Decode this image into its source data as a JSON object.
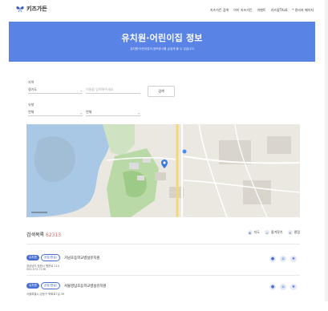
{
  "header": {
    "brand": "키즈가든",
    "nav": [
      "키즈가든 검색",
      "아이 키즈가든",
      "이벤트",
      "키즈맘TALK",
      "* 관리자 페이지"
    ]
  },
  "hero": {
    "title": "유치원·어린이집 정보",
    "subtitle": "유치원·어린이집의 정보공시를 손쉽게 볼 수 있습니다"
  },
  "search": {
    "region_label": "지역",
    "region_value": "경기도",
    "name_placeholder": "이름을 입력해주세요",
    "search_button": "검색",
    "type_label": "유형",
    "type_value": "전체",
    "type2_value": "전체"
  },
  "results": {
    "label": "검색목록",
    "count": "62313",
    "filters": [
      "지도",
      "즐겨찾기",
      "평점"
    ],
    "items": [
      {
        "type_badge": "유치원",
        "kind_badge": "공립(병설)",
        "name": "가남초등학교병설유치원",
        "address": "경상남도 창원시 행운로 114",
        "phone": "000-572-7136"
      },
      {
        "type_badge": "유치원",
        "kind_badge": "공립(병설)",
        "name": "서울영답초등학교병설유치원",
        "address": "서울특별시 강동구 북화로7길 39",
        "phone": ""
      }
    ]
  },
  "colors": {
    "accent": "#5a83e6",
    "badge": "#4a6fd4",
    "count": "#e05a5a"
  }
}
